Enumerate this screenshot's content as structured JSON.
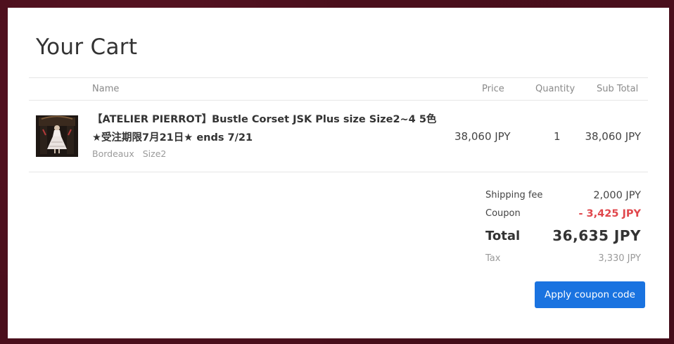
{
  "page": {
    "title": "Your Cart"
  },
  "columns": {
    "name": "Name",
    "price": "Price",
    "quantity": "Quantity",
    "subtotal": "Sub Total"
  },
  "items": [
    {
      "name": "【ATELIER PIERROT】Bustle Corset JSK Plus size Size2~4 5色 ★受注期限7月21日★ ends 7/21",
      "variant_color": "Bordeaux",
      "variant_size": "Size2",
      "price": "38,060 JPY",
      "quantity": "1",
      "subtotal": "38,060 JPY",
      "thumbnail_icon": "dress-photo"
    }
  ],
  "summary": {
    "shipping_label": "Shipping fee",
    "shipping_value": "2,000 JPY",
    "coupon_label": "Coupon",
    "coupon_value": "- 3,425 JPY",
    "total_label": "Total",
    "total_value": "36,635 JPY",
    "tax_label": "Tax",
    "tax_value": "3,330 JPY"
  },
  "actions": {
    "apply_coupon": "Apply coupon code"
  },
  "colors": {
    "accent": "#1a73e0",
    "discount": "#e0474c",
    "frame": "#4a0f1c"
  }
}
